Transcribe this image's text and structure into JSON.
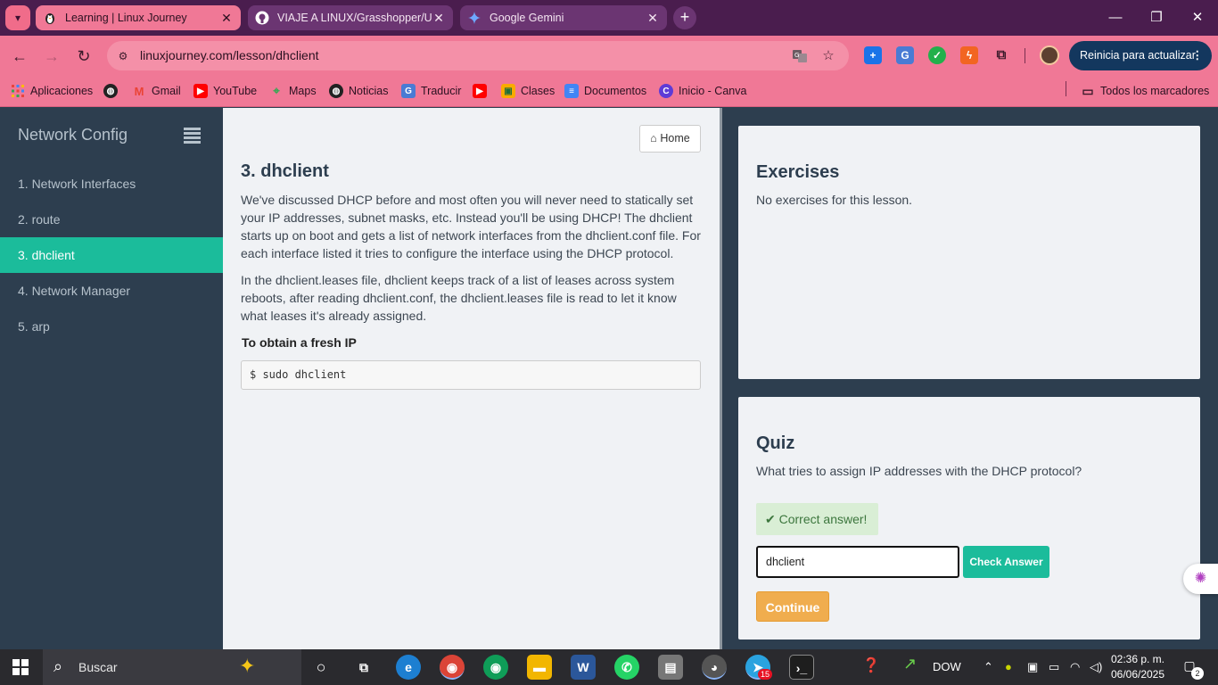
{
  "browser": {
    "tabs": [
      {
        "title": "Learning | Linux Journey",
        "active": true,
        "favicon": "penguin-icon"
      },
      {
        "title": "VIAJE A LINUX/Grasshopper/Us",
        "active": false,
        "favicon": "github-icon"
      },
      {
        "title": "Google Gemini",
        "active": false,
        "favicon": "gemini-icon"
      }
    ],
    "url": "linuxjourney.com/lesson/dhclient",
    "update_button": "Reinicia para actualizar",
    "bookmarks": [
      {
        "label": "Aplicaciones",
        "icon": "apps-grid-icon"
      },
      {
        "label": "",
        "icon": "globe-icon"
      },
      {
        "label": "Gmail",
        "icon": "gmail-icon"
      },
      {
        "label": "YouTube",
        "icon": "youtube-icon"
      },
      {
        "label": "Maps",
        "icon": "maps-icon"
      },
      {
        "label": "Noticias",
        "icon": "globe-icon"
      },
      {
        "label": "Traducir",
        "icon": "translate-icon"
      },
      {
        "label": "",
        "icon": "youtube-icon"
      },
      {
        "label": "Clases",
        "icon": "classroom-icon"
      },
      {
        "label": "Documentos",
        "icon": "docs-icon"
      },
      {
        "label": "Inicio - Canva",
        "icon": "canva-icon"
      }
    ],
    "all_bookmarks": "Todos los marcadores"
  },
  "sidebar": {
    "title": "Network Config",
    "items": [
      {
        "label": "1. Network Interfaces",
        "active": false
      },
      {
        "label": "2. route",
        "active": false
      },
      {
        "label": "3. dhclient",
        "active": true
      },
      {
        "label": "4. Network Manager",
        "active": false
      },
      {
        "label": "5. arp",
        "active": false
      }
    ]
  },
  "lesson": {
    "home_label": "Home",
    "title": "3. dhclient",
    "para1": "We've discussed DHCP before and most often you will never need to statically set your IP addresses, subnet masks, etc. Instead you'll be using DHCP! The dhclient starts up on boot and gets a list of network interfaces from the dhclient.conf file. For each interface listed it tries to configure the interface using the DHCP protocol.",
    "para2": "In the dhclient.leases file, dhclient keeps track of a list of leases across system reboots, after reading dhclient.conf, the dhclient.leases file is read to let it know what leases it's already assigned.",
    "subheading": "To obtain a fresh IP",
    "code": "$ sudo dhclient"
  },
  "exercises": {
    "title": "Exercises",
    "text": "No exercises for this lesson."
  },
  "quiz": {
    "title": "Quiz",
    "question": "What tries to assign IP addresses with the DHCP protocol?",
    "feedback": "Correct answer!",
    "answer_value": "dhclient",
    "check_label": "Check Answer",
    "continue_label": "Continue"
  },
  "taskbar": {
    "search_placeholder": "Buscar",
    "tray_label": "DOW",
    "time": "02:36 p. m.",
    "date": "06/06/2025",
    "telegram_badge": "15",
    "notification_count": "2"
  },
  "colors": {
    "accent": "#1bbc9b",
    "sidebar_bg": "#2d3e4f",
    "chrome_pink": "#f07896",
    "tab_strip": "#4a1d4e",
    "continue": "#f0ad4e"
  }
}
